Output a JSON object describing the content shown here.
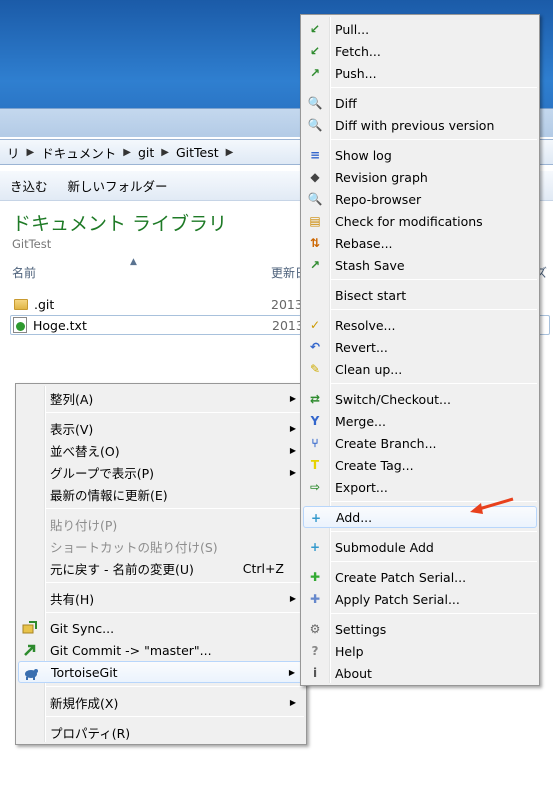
{
  "address": {
    "crumbs": [
      "リ",
      "ドキュメント",
      "git",
      "GitTest"
    ]
  },
  "toolbar": {
    "items": [
      "き込む",
      "新しいフォルダー"
    ]
  },
  "library": {
    "title": "ドキュメント ライブラリ",
    "subtitle": "GitTest"
  },
  "columns": {
    "name": "名前",
    "date": "更新日",
    "size": "ズ"
  },
  "files": [
    {
      "name": ".git",
      "date": "2013"
    },
    {
      "name": "Hoge.txt",
      "date": "2013"
    }
  ],
  "context_menu": {
    "items": [
      {
        "label": "整列(A)"
      },
      {
        "label": "表示(V)"
      },
      {
        "label": "並べ替え(O)"
      },
      {
        "label": "グループで表示(P)"
      },
      {
        "label": "最新の情報に更新(E)"
      },
      {
        "label": "貼り付け(P)"
      },
      {
        "label": "ショートカットの貼り付け(S)"
      },
      {
        "label": "元に戻す - 名前の変更(U)",
        "shortcut": "Ctrl+Z"
      },
      {
        "label": "共有(H)"
      },
      {
        "label": "Git Sync..."
      },
      {
        "label": "Git Commit -> \"master\"..."
      },
      {
        "label": "TortoiseGit"
      },
      {
        "label": "新規作成(X)"
      },
      {
        "label": "プロパティ(R)"
      }
    ]
  },
  "tortoise_menu": {
    "items": [
      {
        "label": "Pull...",
        "icon": "pull-icon",
        "color": "#2e8b2e"
      },
      {
        "label": "Fetch...",
        "icon": "fetch-icon",
        "color": "#2e8b2e"
      },
      {
        "label": "Push...",
        "icon": "push-icon",
        "color": "#2e8b2e"
      },
      {
        "label": "Diff",
        "icon": "diff-icon",
        "color": "#555555"
      },
      {
        "label": "Diff with previous version",
        "icon": "diff-previous-icon",
        "color": "#555555"
      },
      {
        "label": "Show log",
        "icon": "log-icon",
        "color": "#3366cc"
      },
      {
        "label": "Revision graph",
        "icon": "revision-graph-icon",
        "color": "#444444"
      },
      {
        "label": "Repo-browser",
        "icon": "repo-browser-icon",
        "color": "#b07b1c"
      },
      {
        "label": "Check for modifications",
        "icon": "check-modifications-icon",
        "color": "#cc8800"
      },
      {
        "label": "Rebase...",
        "icon": "rebase-icon",
        "color": "#cc6600"
      },
      {
        "label": "Stash Save",
        "icon": "stash-icon",
        "color": "#2e8b2e"
      },
      {
        "label": "Bisect start",
        "icon": "",
        "color": ""
      },
      {
        "label": "Resolve...",
        "icon": "resolve-icon",
        "color": "#cc9900"
      },
      {
        "label": "Revert...",
        "icon": "revert-icon",
        "color": "#3366cc"
      },
      {
        "label": "Clean up...",
        "icon": "cleanup-icon",
        "color": "#ccaa00"
      },
      {
        "label": "Switch/Checkout...",
        "icon": "switch-icon",
        "color": "#2e8b2e"
      },
      {
        "label": "Merge...",
        "icon": "merge-icon",
        "color": "#3366cc"
      },
      {
        "label": "Create Branch...",
        "icon": "branch-icon",
        "color": "#3366cc"
      },
      {
        "label": "Create Tag...",
        "icon": "tag-icon",
        "color": "#e6d200"
      },
      {
        "label": "Export...",
        "icon": "export-icon",
        "color": "#2e8b2e"
      },
      {
        "label": "Add...",
        "icon": "add-icon",
        "color": "#3399cc"
      },
      {
        "label": "Submodule Add",
        "icon": "submodule-add-icon",
        "color": "#3399cc"
      },
      {
        "label": "Create Patch Serial...",
        "icon": "patch-icon",
        "color": "#33aa33"
      },
      {
        "label": "Apply Patch Serial...",
        "icon": "apply-patch-icon",
        "color": "#6688cc"
      },
      {
        "label": "Settings",
        "icon": "settings-icon",
        "color": "#666666"
      },
      {
        "label": "Help",
        "icon": "help-icon",
        "color": "#888888"
      },
      {
        "label": "About",
        "icon": "about-icon",
        "color": "#555555"
      }
    ]
  },
  "accent": {
    "highlight": "#cce4fb",
    "arrow": "#e8401c",
    "library_title": "#1e7a26"
  }
}
